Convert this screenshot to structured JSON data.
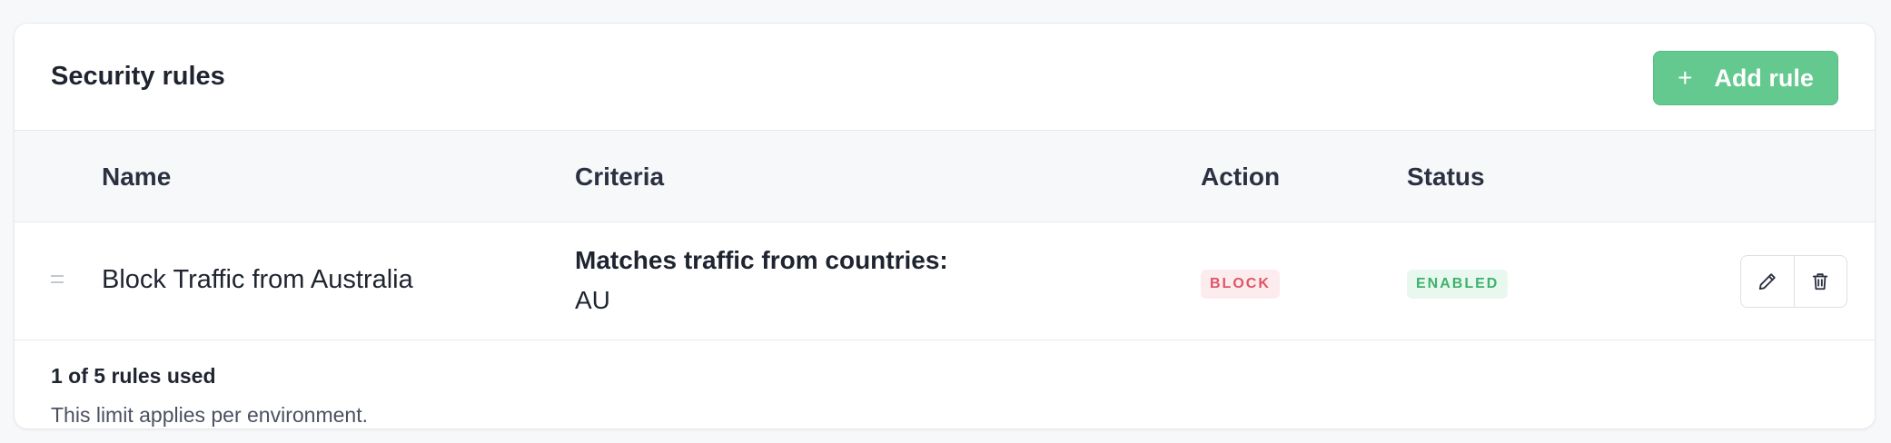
{
  "header": {
    "title": "Security rules",
    "add_button_icon": "+",
    "add_button_label": "Add rule"
  },
  "table": {
    "columns": [
      "Name",
      "Criteria",
      "Action",
      "Status"
    ],
    "rows": [
      {
        "name": "Block Traffic from Australia",
        "criteria_title": "Matches traffic from countries:",
        "criteria_value": "AU",
        "action": "BLOCK",
        "status": "ENABLED"
      }
    ]
  },
  "footer": {
    "usage": "1 of 5 rules used",
    "note": "This limit applies per environment."
  },
  "colors": {
    "primary": "#63c98f",
    "block": "#e15465",
    "enabled": "#3eb16c"
  },
  "icons": {
    "drag": "drag-handle-icon",
    "edit": "pencil-icon",
    "delete": "trash-icon"
  }
}
